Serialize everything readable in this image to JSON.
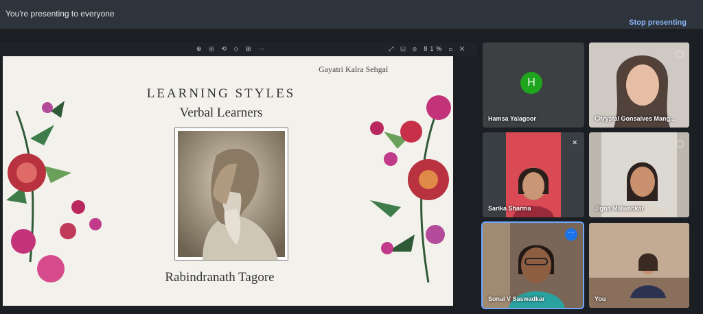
{
  "banner": {
    "message": "You're presenting to everyone",
    "stop_label": "Stop presenting"
  },
  "slide_toolbar": {
    "left_icons": "⊕ ◎ ⟲ ◇ ⊞ ⋯",
    "right_icons": "⤢ ◱ ⊕ 81% ◻ ✕"
  },
  "slide": {
    "author": "Gayatri Kalra Sehgal",
    "title": "LEARNING STYLES",
    "subtitle": "Verbal Learners",
    "caption": "Rabindranath Tagore"
  },
  "participants": [
    {
      "name": "Hamsa Yalagoor",
      "initial": "H"
    },
    {
      "name": "Chrystal Gonsalves Mang..."
    },
    {
      "name": "Sarika Sharma"
    },
    {
      "name": "Jigna Malwankar"
    },
    {
      "name": "Sonal V Saswadkar"
    },
    {
      "name": "You"
    }
  ],
  "colors": {
    "accent": "#8ab4f8",
    "avatar_bg": "#1fa51d",
    "active_border": "#6ea8fe"
  }
}
